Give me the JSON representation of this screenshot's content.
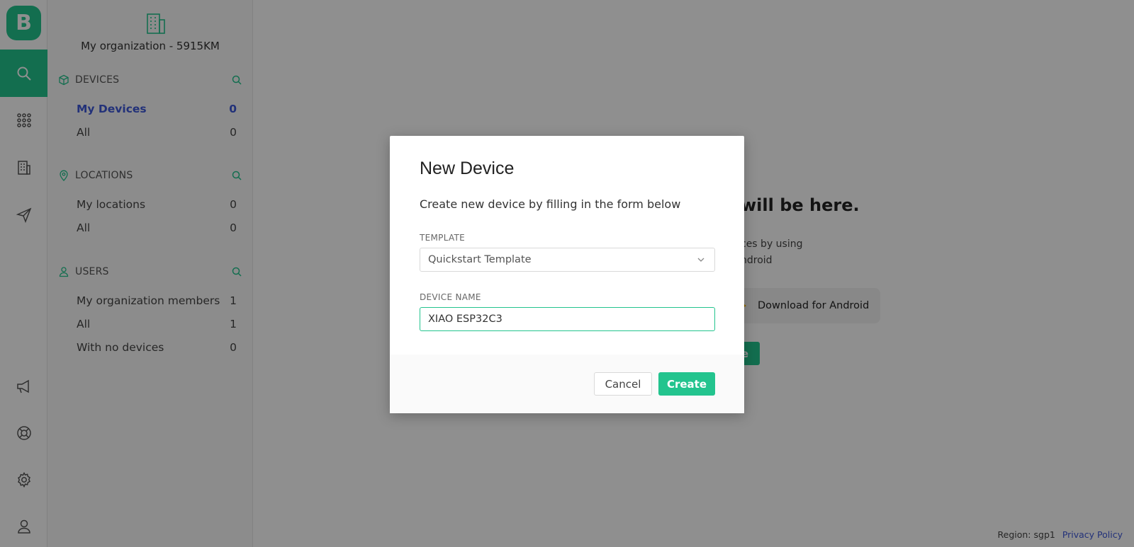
{
  "brand": {
    "logo_letter": "B",
    "accent": "#23c48e",
    "link_color": "#3e58d8"
  },
  "rail": {
    "items": [
      {
        "icon": "search-icon",
        "active": true
      },
      {
        "icon": "grid-icon",
        "active": false
      },
      {
        "icon": "building-icon",
        "active": false
      },
      {
        "icon": "send-icon",
        "active": false
      },
      {
        "icon": "megaphone-icon",
        "active": false
      },
      {
        "icon": "lifebuoy-icon",
        "active": false
      },
      {
        "icon": "gear-icon",
        "active": false
      },
      {
        "icon": "user-profile-icon",
        "active": false
      }
    ]
  },
  "sidebar": {
    "org_name": "My organization - 5915KM",
    "devices": {
      "heading": "DEVICES",
      "items": [
        {
          "label": "My Devices",
          "count": "0"
        },
        {
          "label": "All",
          "count": "0"
        }
      ]
    },
    "locations": {
      "heading": "LOCATIONS",
      "items": [
        {
          "label": "My locations",
          "count": "0"
        },
        {
          "label": "All",
          "count": "0"
        }
      ]
    },
    "users": {
      "heading": "USERS",
      "items": [
        {
          "label": "My organization members",
          "count": "1"
        },
        {
          "label": "All",
          "count": "1"
        },
        {
          "label": "With no devices",
          "count": "0"
        }
      ]
    }
  },
  "background": {
    "empty_title_partial": "will be here.",
    "sub_line1_partial": "ces by using",
    "sub_line2_partial": "ndroid",
    "android_button": "Download for Android",
    "green_button_partial": "e"
  },
  "modal": {
    "title": "New Device",
    "description": "Create new device by filling in the form below",
    "template_label": "TEMPLATE",
    "template_value": "Quickstart Template",
    "device_name_label": "DEVICE NAME",
    "device_name_value": "XIAO ESP32C3",
    "cancel_label": "Cancel",
    "create_label": "Create"
  },
  "footer": {
    "region": "Region: sgp1",
    "privacy": "Privacy Policy"
  }
}
